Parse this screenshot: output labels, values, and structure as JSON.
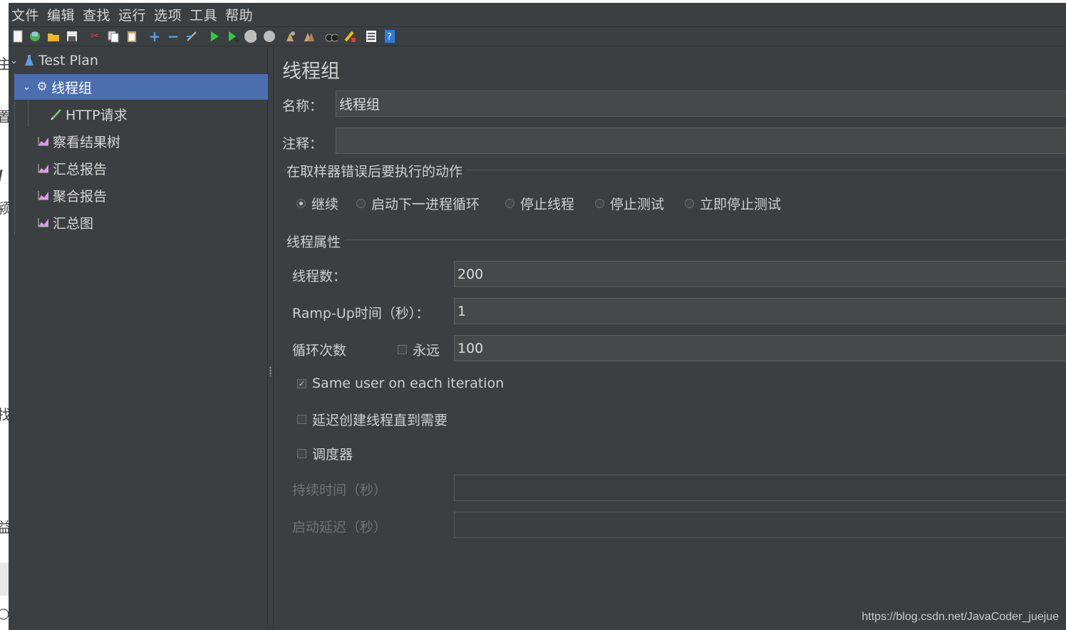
{
  "menu": [
    "文件",
    "编辑",
    "查找",
    "运行",
    "选项",
    "工具",
    "帮助"
  ],
  "toolbar_icons": [
    "new-icon",
    "templates-icon",
    "open-icon",
    "save-icon",
    "cut-icon",
    "copy-icon",
    "paste-icon",
    "expand-icon",
    "collapse-icon",
    "toggle-icon",
    "start-icon",
    "start-no-pause-icon",
    "stop-icon",
    "shutdown-icon",
    "clear-icon",
    "clear-all-icon",
    "search-icon",
    "reset-search-icon",
    "function-helper-icon",
    "help-icon"
  ],
  "tree": {
    "root": "Test Plan",
    "thread_group": "线程组",
    "http_request": "HTTP请求",
    "listeners": [
      "察看结果树",
      "汇总报告",
      "聚合报告",
      "汇总图"
    ]
  },
  "panel": {
    "title": "线程组",
    "name_label": "名称：",
    "name_value": "线程组",
    "comment_label": "注释：",
    "comment_value": "",
    "error_action_title": "在取样器错误后要执行的动作",
    "error_actions": [
      {
        "label": "继续",
        "selected": true
      },
      {
        "label": "启动下一进程循环",
        "selected": false
      },
      {
        "label": "停止线程",
        "selected": false
      },
      {
        "label": "停止测试",
        "selected": false
      },
      {
        "label": "立即停止测试",
        "selected": false
      }
    ],
    "thread_props_title": "线程属性",
    "threads_label": "线程数：",
    "threads_value": "200",
    "rampup_label": "Ramp-Up时间（秒）：",
    "rampup_value": "1",
    "loop_label": "循环次数",
    "forever_label": "永远",
    "forever_checked": false,
    "loop_value": "100",
    "same_user_label": "Same user on each iteration",
    "same_user_checked": true,
    "delay_label": "延迟创建线程直到需要",
    "delay_checked": false,
    "scheduler_label": "调度器",
    "scheduler_checked": false,
    "duration_label": "持续时间（秒）",
    "duration_value": "",
    "startup_delay_label": "启动延迟（秒）",
    "startup_delay_value": ""
  },
  "watermark": "https://blog.csdn.net/JavaCoder_juejue",
  "colors": {
    "background": "#3c3f41",
    "selection": "#4b6eaf",
    "field_bg": "#45494a",
    "text": "#cfcfcf"
  }
}
